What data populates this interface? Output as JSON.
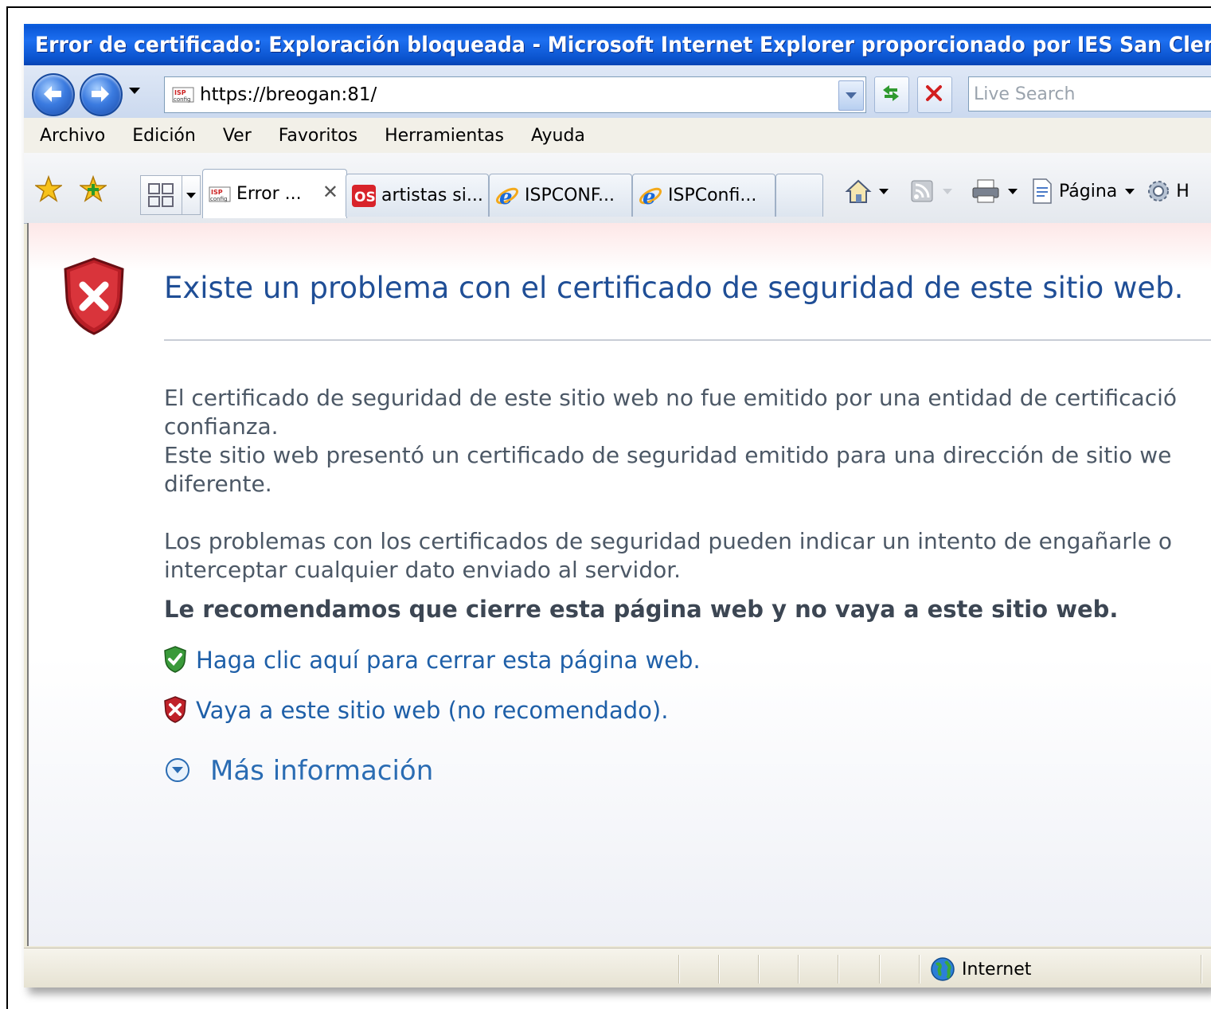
{
  "window": {
    "title": "Error de certificado: Exploración bloqueada - Microsoft Internet Explorer proporcionado por IES San Clemente"
  },
  "address_bar": {
    "url": "https://breogan:81/",
    "search_placeholder": "Live Search"
  },
  "menu": [
    "Archivo",
    "Edición",
    "Ver",
    "Favoritos",
    "Herramientas",
    "Ayuda"
  ],
  "tabs": [
    {
      "label": "Error ...",
      "icon": "ispconfig-favicon",
      "active": true
    },
    {
      "label": "artistas si...",
      "icon": "os-favicon",
      "active": false
    },
    {
      "label": "ISPCONF...",
      "icon": "ie-icon",
      "active": false
    },
    {
      "label": "ISPConfi...",
      "icon": "ie-icon",
      "active": false
    },
    {
      "label": "",
      "icon": "",
      "active": false
    }
  ],
  "toolbar": {
    "page_label": "Página",
    "tools_label_partial": "H"
  },
  "content": {
    "heading": "Existe un problema con el certificado de seguridad de este sitio web.",
    "para1_line1": "El certificado de seguridad de este sitio web no fue emitido por una entidad de certificació",
    "para1_line2": "confianza.",
    "para2_line1": "Este sitio web presentó un certificado de seguridad emitido para una dirección de sitio we",
    "para2_line2": "diferente.",
    "para3_line1": "Los problemas con los certificados de seguridad pueden indicar un intento de engañarle o",
    "para3_line2": "interceptar cualquier dato enviado al servidor.",
    "recommendation": "Le recomendamos que cierre esta página web y no vaya a este sitio web.",
    "close_link": "Haga clic aquí para cerrar esta página web.",
    "continue_link": "Vaya a este sitio web (no recomendado).",
    "more_info": "Más información"
  },
  "status": {
    "zone": "Internet"
  },
  "colors": {
    "title_bar": "#0b58d8",
    "heading": "#1f4e96",
    "link": "#1e5fa8",
    "shield_red": "#c0222a",
    "shield_green": "#3a9a3a"
  }
}
